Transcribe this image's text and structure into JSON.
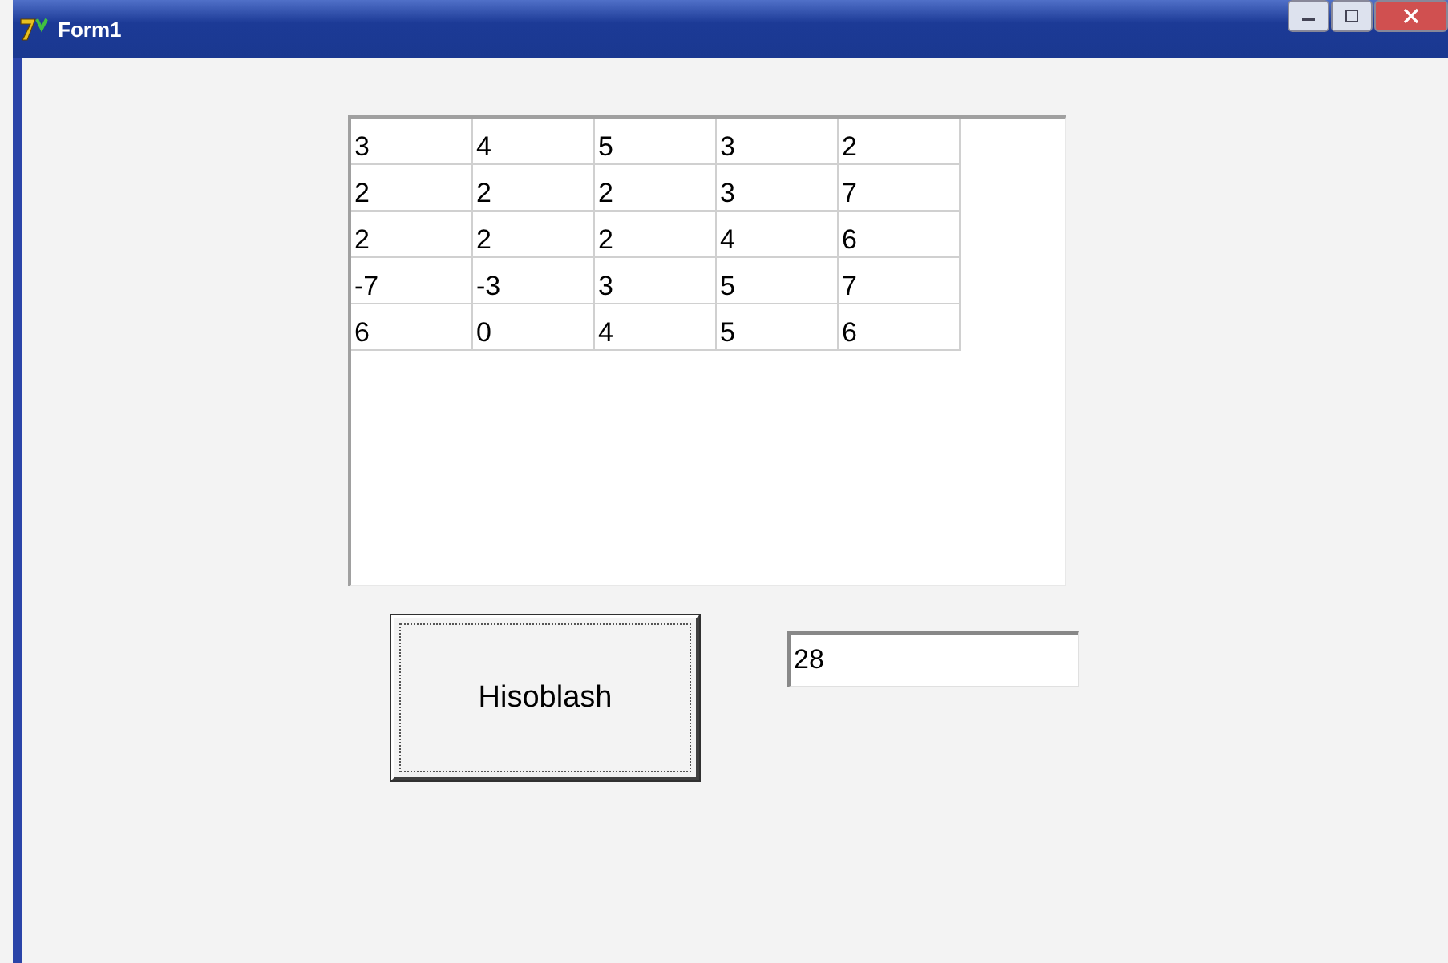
{
  "window": {
    "title": "Form1"
  },
  "grid": {
    "rows": [
      [
        "3",
        "4",
        "5",
        "3",
        "2"
      ],
      [
        "2",
        "2",
        "2",
        "3",
        "7"
      ],
      [
        "2",
        "2",
        "2",
        "4",
        "6"
      ],
      [
        "-7",
        "-3",
        "3",
        "5",
        "7"
      ],
      [
        "6",
        "0",
        "4",
        "5",
        "6"
      ]
    ]
  },
  "button": {
    "label": "Hisoblash"
  },
  "result": {
    "value": "28"
  }
}
